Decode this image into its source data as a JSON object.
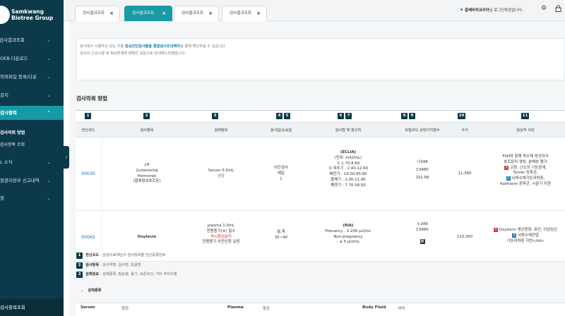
{
  "sidebar": {
    "brand_line1": "Samkwang",
    "brand_line2": "Biotree Group",
    "items": [
      {
        "label": "검사결과조회"
      },
      {
        "label": "OEB 다운로드"
      },
      {
        "label": "의뢰파일 등록/다운"
      },
      {
        "label": "공지"
      },
      {
        "label": "검사항목"
      },
      {
        "label": "L 소식"
      },
      {
        "label": "원관리본부 신고내역"
      },
      {
        "label": "정"
      }
    ],
    "sub_items": [
      {
        "label": "검사의뢰 방법"
      },
      {
        "label": "검사항목 조회"
      }
    ],
    "bottom_label": "검사항목조회"
  },
  "tabs": [
    {
      "label": "검사결과조회",
      "close": "×"
    },
    {
      "label": "검사결과조회",
      "close": "×"
    },
    {
      "label": "검사결과조회",
      "close": "×"
    },
    {
      "label": "검사결과조회",
      "close": "×"
    }
  ],
  "header": {
    "notice_user": "홍베비피코리아",
    "notice_text": "님 로그인하셨습니다.",
    "settings_icon": "gear-icon",
    "lock_icon": "lock-icon"
  },
  "info": {
    "line1_pre": "당사에서 시행하고 있는 각종 ",
    "line1_highlight": "임상진단검사들을 종합검사안내책자",
    "line1_post": "를 통해 확인하실 수 있습니다.",
    "line2": "검사의 신규시행 및 정보변경에 대해선 공문으로 안내해드리겠습니다."
  },
  "section_title": "검사의뢰 방법",
  "table": {
    "badges": [
      "1",
      "2",
      "3",
      "4",
      "5",
      "6",
      "7",
      "8",
      "9",
      "10",
      "11"
    ],
    "headers": [
      "전산코드",
      "검사항목",
      "검체정보",
      "검사일/소요일",
      "검사법 및 참고치",
      "보험코드 상대가치점수",
      "수가",
      "임상적 의의"
    ],
    "rows": [
      {
        "code": "00030",
        "item_lines": [
          "LH",
          "(Luteinizing",
          "Hormone)",
          "(황체형성호르몬)"
        ],
        "specimen": "Serum 0.5mL",
        "specimen_note": "냉장",
        "days_lines": [
          "이간검사",
          "매일",
          "1"
        ],
        "method_lines": [
          "(ECLIA)",
          "(단위: mIU/mL)",
          "① 1.70-8.60",
          "② 여포기 : 2.40-12.60",
          "배란기 : 14.00-95.60",
          "황체기 : 1.00-11.40",
          "폐경기 : 7.70-58.50"
        ],
        "insurance_lines": [
          "나348",
          "C3480",
          "",
          "152.68"
        ],
        "price": "11,360",
        "clinical_line1": "FSH와 함께 하수체 성선자극",
        "clinical_line2": "호르몬의 생성, 분배능 평가",
        "clinical_up_mark": "↑",
        "clinical_up_text": "고환, 난소의 기능장애,",
        "clinical_line4": "Turner 증후군,",
        "clinical_down_mark": "↓",
        "clinical_down_text": "뇌하수체기능저하증,",
        "clinical_line6": "Kallmann 증후군, 시춘기 지연"
      },
      {
        "code": "00062",
        "item_lines": [
          "Oxytocin"
        ],
        "specimen": "plasma 1.0mL",
        "specimen_note_prefix": "전용용기(",
        "specimen_note_mid": "④",
        "specimen_note_suffix": ") 필수",
        "specimen_red": "즉시원심분리",
        "specimen_tail": "전용용기 사전신청 요망",
        "days_lines": [
          "월,목",
          "35~40"
        ],
        "method_lines": [
          "(RIA)",
          "Prenancy : 3-200 μU/mL",
          "Non-pregnancy",
          ": ≤ 5 μU/mL"
        ],
        "insurance_lines": [
          "노348",
          "C3480"
        ],
        "insurance_icon": "calendar-icon",
        "price": "110,300",
        "clinical_up_mark": "↑",
        "clinical_up_text": "Oxytocin 생산종양, 유산, 이상임신",
        "clinical_down_mark": "↓",
        "clinical_down_text": "뇌하수체전엽",
        "clinical_line3": "기능저하증 지연</td>"
      }
    ]
  },
  "legend": [
    {
      "num": "1",
      "title": "전산코드",
      "text": " : 삼광의료재단의 검사항목별 전산등록번호"
    },
    {
      "num": "2",
      "title": "검사항목",
      "text": " : 검사약명, 검사명, 한글명"
    },
    {
      "num": "3",
      "title": "검체정보",
      "text": " : 검체종류, 필요량, 용기, 보존조건, 기타 주의사항"
    }
  ],
  "specimen_panel": {
    "toggle": "검체종류",
    "items": [
      {
        "label": "Serum",
        "value": "혈청"
      },
      {
        "label": "Plasma",
        "value": "혈장"
      },
      {
        "label": "Body Fluid",
        "value": "체액"
      }
    ]
  }
}
